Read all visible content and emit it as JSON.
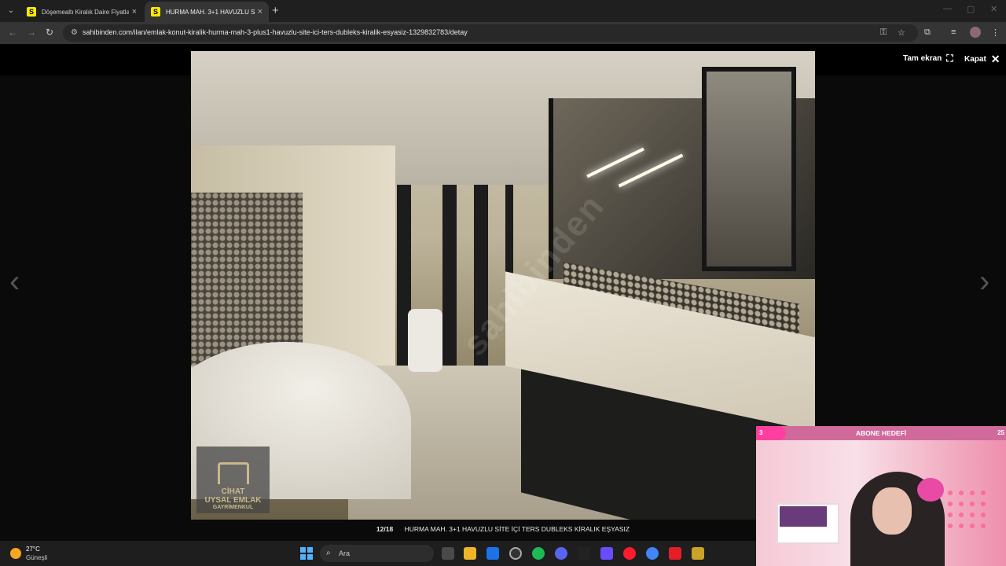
{
  "browser": {
    "tabs": [
      {
        "favicon": "S",
        "label": "Döşemealtı Kiralık Daire Fiyatları",
        "active": false
      },
      {
        "favicon": "S",
        "label": "HURMA MAH. 3+1 HAVUZLU S",
        "active": true
      }
    ],
    "url": "sahibinden.com/ilan/emlak-konut-kiralik-hurma-mah-3-plus1-havuzlu-site-ici-ters-dubleks-kiralik-esyasiz-1329832783/detay"
  },
  "viewer": {
    "fullscreen_label": "Tam ekran",
    "close_label": "Kapat",
    "counter": "12/18",
    "caption": "HURMA MAH. 3+1 HAVUZLU SİTE İÇİ TERS DUBLEKS KİRALIK EŞYASIZ",
    "watermark": "sahibinden",
    "logo": {
      "line1": "CİHAT",
      "line2": "UYSAL EMLAK",
      "line3": "GAYRİMENKUL"
    }
  },
  "overlay": {
    "goal_current": "3",
    "goal_title": "ABONE HEDEFİ",
    "goal_target": "25",
    "goal_progress": 0.12
  },
  "taskbar": {
    "temperature": "27°C",
    "condition": "Güneşli",
    "search_placeholder": "Ara"
  },
  "colors": {
    "favicon_bg": "#ffe800",
    "goal_accent": "#ff3fa0",
    "logo_gold": "#c8b98a"
  }
}
